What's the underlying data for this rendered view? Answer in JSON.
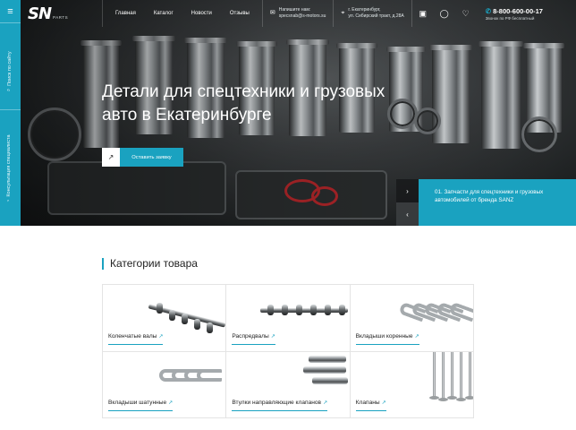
{
  "header": {
    "logo_text": "SN",
    "logo_sub": "PARTS",
    "nav": [
      "Главная",
      "Каталог",
      "Новости",
      "Отзывы"
    ],
    "email_label": "Напишите нам:",
    "email": "specsnab@s-motors.su",
    "address_line1": "г. Екатеринбург,",
    "address_line2": "ул. Сибирский тракт, д.28А",
    "phone": "8-800-600-00-17",
    "phone_note": "Звонок по РФ бесплатный"
  },
  "rail": {
    "search_label": "Поиск по сайту",
    "consult_label": "Консультация специалиста"
  },
  "hero": {
    "title": "Детали для спецтехники и грузовых авто в Екатеринбурге",
    "cta_label": "Оставить заявку",
    "slide_card": "01. Запчасти для спецтехники и грузовых автомобилей от бренда SANZ"
  },
  "categories": {
    "title": "Категории товара",
    "items": [
      {
        "label": "Коленчатые валы"
      },
      {
        "label": "Распредвалы"
      },
      {
        "label": "Вкладыши коренные"
      },
      {
        "label": "Вкладыши шатунные"
      },
      {
        "label": "Втулки направляющие клапанов"
      },
      {
        "label": "Клапаны"
      }
    ]
  },
  "colors": {
    "accent": "#1aa2c0",
    "hero_dark": "#1f2223"
  },
  "icons": [
    "menu-icon",
    "search-icon",
    "chat-icon",
    "mail-icon",
    "location-icon",
    "compare-icon",
    "user-icon",
    "heart-icon",
    "phone-icon",
    "arrow-up-right-icon",
    "chevron-right-icon",
    "chevron-left-icon"
  ]
}
